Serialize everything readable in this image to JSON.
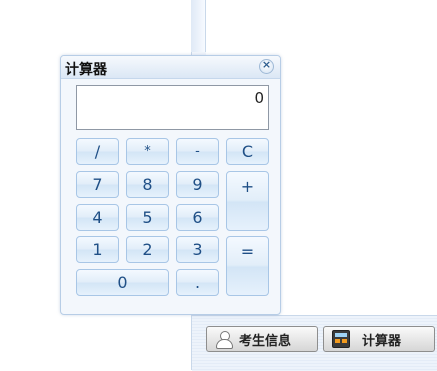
{
  "calculator": {
    "title": "计算器",
    "close_icon": "close-icon",
    "display_value": "0",
    "keys": {
      "divide": "/",
      "multiply": "*",
      "subtract": "-",
      "clear": "C",
      "seven": "7",
      "eight": "8",
      "nine": "9",
      "add": "+",
      "four": "4",
      "five": "5",
      "six": "6",
      "one": "1",
      "two": "2",
      "three": "3",
      "equals": "=",
      "zero": "0",
      "decimal": "."
    }
  },
  "toolbar": {
    "student_info_label": "考生信息",
    "student_info_icon": "person-icon",
    "calculator_label": "计算器",
    "calculator_icon": "calculator-icon"
  },
  "colors": {
    "dialog_bg": "#f3f7fc",
    "key_text": "#1f4f86",
    "key_border": "#a8c6e6",
    "accent_orange": "#f39b1e"
  }
}
